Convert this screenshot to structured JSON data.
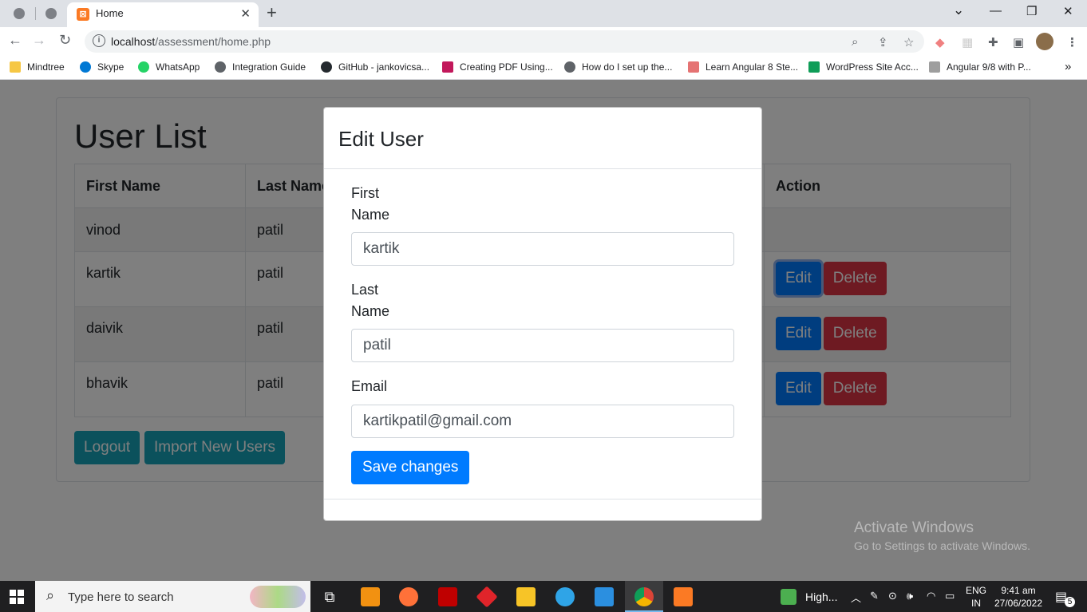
{
  "browser": {
    "tab_title": "Home",
    "tab_close": "✕",
    "new_tab": "+",
    "url_host": "localhost",
    "url_path": "/assessment/home.php",
    "window_controls": {
      "dropdown": "⌄",
      "minimize": "—",
      "restore": "❐",
      "close": "✕"
    }
  },
  "bookmarks": [
    {
      "label": "Mindtree",
      "color": "#f6c744"
    },
    {
      "label": "Skype",
      "color": "#0078d4"
    },
    {
      "label": "WhatsApp",
      "color": "#25d366"
    },
    {
      "label": "Integration Guide",
      "color": "#5f6368"
    },
    {
      "label": "GitHub - jankovicsa...",
      "color": "#24292e"
    },
    {
      "label": "Creating PDF Using...",
      "color": "#c2185b"
    },
    {
      "label": "How do I set up the...",
      "color": "#5f6368"
    },
    {
      "label": "Learn Angular 8 Ste...",
      "color": "#e57373"
    },
    {
      "label": "WordPress Site Acc...",
      "color": "#0f9d58"
    },
    {
      "label": "Angular 9/8 with P...",
      "color": "#9e9e9e"
    }
  ],
  "bookmarks_overflow": "»",
  "page": {
    "heading": "User List",
    "table": {
      "headers": [
        "First Name",
        "Last Name",
        "Action"
      ],
      "rows": [
        {
          "first": "vinod",
          "last": "patil"
        },
        {
          "first": "kartik",
          "last": "patil"
        },
        {
          "first": "daivik",
          "last": "patil"
        },
        {
          "first": "bhavik",
          "last": "patil"
        }
      ],
      "edit_label": "Edit",
      "delete_label": "Delete"
    },
    "logout_label": "Logout",
    "import_label": "Import New Users"
  },
  "modal": {
    "title": "Edit User",
    "first_name_label_1": "First",
    "first_name_label_2": "Name",
    "first_name_value": "kartik",
    "last_name_label_1": "Last",
    "last_name_label_2": "Name",
    "last_name_value": "patil",
    "email_label": "Email",
    "email_value": "kartikpatil@gmail.com",
    "save_label": "Save changes"
  },
  "watermark": {
    "line1": "Activate Windows",
    "line2": "Go to Settings to activate Windows."
  },
  "taskbar": {
    "search_placeholder": "Type here to search",
    "weather": "High...",
    "lang_1": "ENG",
    "lang_2": "IN",
    "time": "9:41 am",
    "date": "27/06/2022",
    "notification_count": "5"
  },
  "colors": {
    "primary": "#007bff",
    "danger": "#dc3545",
    "info": "#17a2b8"
  }
}
